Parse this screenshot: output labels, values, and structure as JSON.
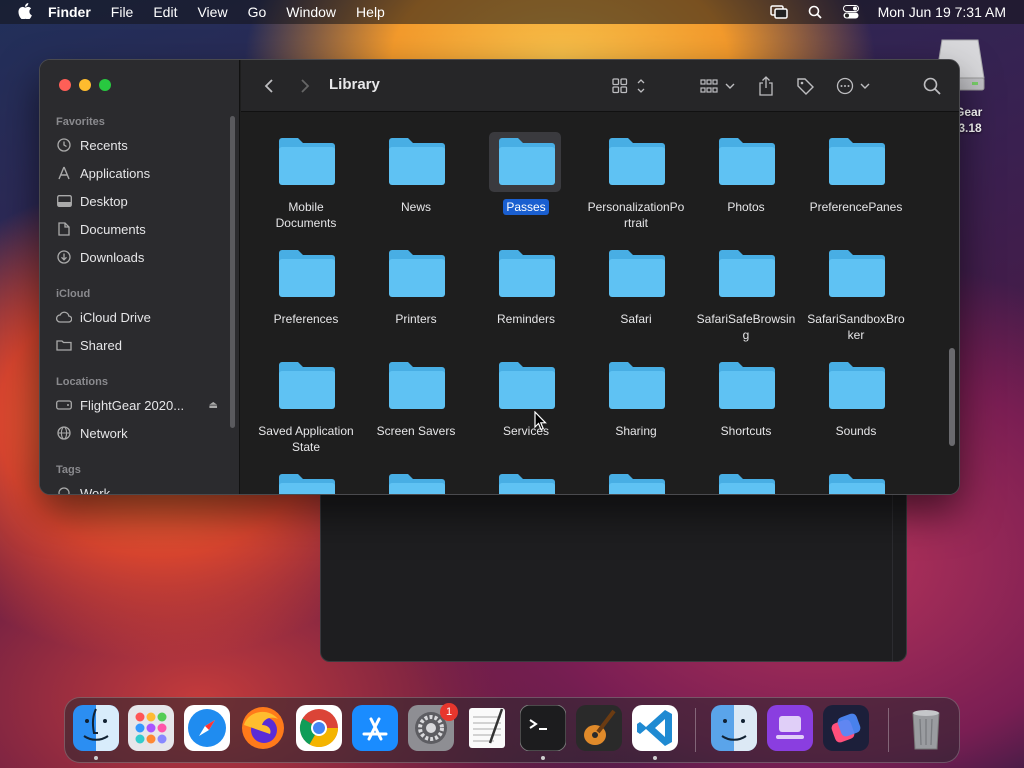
{
  "menubar": {
    "app_name": "Finder",
    "items": [
      "File",
      "Edit",
      "View",
      "Go",
      "Window",
      "Help"
    ],
    "clock": "Mon Jun 19  7:31 AM"
  },
  "desktop": {
    "drive_label_line1": "Gear",
    "drive_label_line2": ".3.18"
  },
  "finder": {
    "title": "Library",
    "sidebar": {
      "favorites_header": "Favorites",
      "favorites": [
        {
          "label": "Recents",
          "icon": "clock-icon"
        },
        {
          "label": "Applications",
          "icon": "applications-icon"
        },
        {
          "label": "Desktop",
          "icon": "desktop-icon"
        },
        {
          "label": "Documents",
          "icon": "document-icon"
        },
        {
          "label": "Downloads",
          "icon": "download-icon"
        }
      ],
      "icloud_header": "iCloud",
      "icloud": [
        {
          "label": "iCloud Drive",
          "icon": "cloud-icon"
        },
        {
          "label": "Shared",
          "icon": "shared-folder-icon"
        }
      ],
      "locations_header": "Locations",
      "locations": [
        {
          "label": "FlightGear 2020...",
          "icon": "disk-icon"
        },
        {
          "label": "Network",
          "icon": "globe-icon"
        }
      ],
      "tags_header": "Tags",
      "tags": [
        {
          "label": "Work",
          "icon": "tag-circle-icon"
        }
      ]
    },
    "items": [
      {
        "label": "Mobile Documents"
      },
      {
        "label": "News"
      },
      {
        "label": "Passes",
        "selected": true
      },
      {
        "label": "PersonalizationPortrait"
      },
      {
        "label": "Photos"
      },
      {
        "label": "PreferencePanes"
      },
      {
        "label": "Preferences"
      },
      {
        "label": "Printers"
      },
      {
        "label": "Reminders"
      },
      {
        "label": "Safari"
      },
      {
        "label": "SafariSafeBrowsing"
      },
      {
        "label": "SafariSandboxBroker"
      },
      {
        "label": "Saved Application State"
      },
      {
        "label": "Screen Savers"
      },
      {
        "label": "Services"
      },
      {
        "label": "Sharing"
      },
      {
        "label": "Shortcuts"
      },
      {
        "label": "Sounds"
      },
      {
        "label": ""
      },
      {
        "label": ""
      },
      {
        "label": ""
      },
      {
        "label": ""
      },
      {
        "label": ""
      },
      {
        "label": ""
      }
    ],
    "items_labels_wrapped": {
      "Mobile Documents": [
        "Mobile",
        "Documents"
      ],
      "PersonalizationPortrait": [
        "PersonalizationPo",
        "rtrait"
      ],
      "SafariSafeBrowsing": [
        "SafariSafeBrowsin",
        "g"
      ],
      "SafariSandboxBroker": [
        "SafariSandboxBro",
        "ker"
      ],
      "Saved Application State": [
        "Saved Application",
        "State"
      ]
    }
  },
  "dock": {
    "apps": [
      "finder-icon",
      "launchpad-icon",
      "safari-icon",
      "firefox-icon",
      "chrome-icon",
      "app-store-icon",
      "system-settings-icon",
      "textedit-icon",
      "terminal-icon",
      "garageband-icon",
      "vscode-icon",
      "finder-alt-icon",
      "podcasts-icon",
      "shortcuts-icon",
      "trash-icon"
    ],
    "settings_badge": "1"
  },
  "colors": {
    "folder": "#5fc2f3",
    "folder_tab": "#48aee4",
    "selection": "#1a5fd0",
    "accent_close": "#fe5f57",
    "accent_min": "#febc2e",
    "accent_max": "#28c840"
  }
}
